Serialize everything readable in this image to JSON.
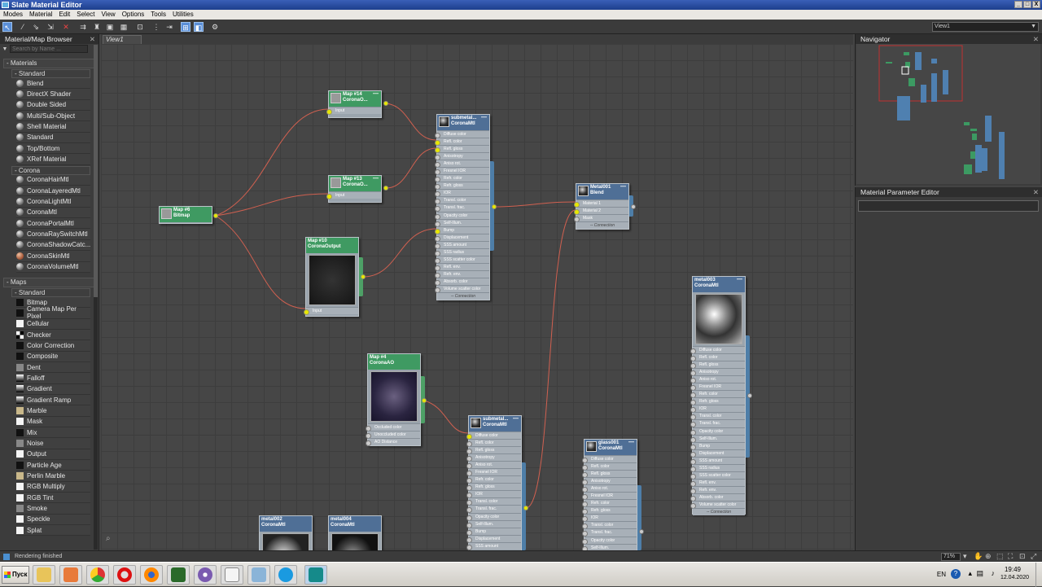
{
  "window": {
    "title": "Slate Material Editor",
    "controls": [
      "_",
      "□",
      "X"
    ]
  },
  "menu": [
    "Modes",
    "Material",
    "Edit",
    "Select",
    "View",
    "Options",
    "Tools",
    "Utilities"
  ],
  "view_select": "View1",
  "browser": {
    "title": "Material/Map Browser",
    "search_placeholder": "Search by Name ...",
    "materials_label": "- Materials",
    "standard_label": "- Standard",
    "standard_items": [
      {
        "label": "Blend",
        "icon": "sphere-icon"
      },
      {
        "label": "DirectX Shader",
        "icon": "sphere-icon"
      },
      {
        "label": "Double Sided",
        "icon": "sphere-icon"
      },
      {
        "label": "Multi/Sub-Object",
        "icon": "sphere-icon"
      },
      {
        "label": "Shell Material",
        "icon": "sphere-icon"
      },
      {
        "label": "Standard",
        "icon": "sphere-icon"
      },
      {
        "label": "Top/Bottom",
        "icon": "sphere-icon"
      },
      {
        "label": "XRef Material",
        "icon": "sphere-icon"
      }
    ],
    "corona_label": "- Corona",
    "corona_items": [
      {
        "label": "CoronaHairMtl",
        "icon": "sphere-icon"
      },
      {
        "label": "CoronaLayeredMtl",
        "icon": "sphere-icon"
      },
      {
        "label": "CoronaLightMtl",
        "icon": "sphere-icon"
      },
      {
        "label": "CoronaMtl",
        "icon": "sphere-icon"
      },
      {
        "label": "CoronaPortalMtl",
        "icon": "sphere-icon"
      },
      {
        "label": "CoronaRaySwitchMtl",
        "icon": "sphere-icon"
      },
      {
        "label": "CoronaShadowCatc...",
        "icon": "sphere-icon"
      },
      {
        "label": "CoronaSkinMtl",
        "icon": "sphere-icon"
      },
      {
        "label": "CoronaVolumeMtl",
        "icon": "sphere-icon"
      }
    ],
    "maps_label": "- Maps",
    "maps_standard_label": "- Standard",
    "map_items": [
      {
        "label": "Bitmap",
        "icon": "black-swatch-icon"
      },
      {
        "label": "Camera Map Per Pixel",
        "icon": "black-swatch-icon"
      },
      {
        "label": "Cellular",
        "icon": "white-swatch-icon"
      },
      {
        "label": "Checker",
        "icon": "checker-icon"
      },
      {
        "label": "Color Correction",
        "icon": "black-swatch-icon"
      },
      {
        "label": "Composite",
        "icon": "black-swatch-icon"
      },
      {
        "label": "Dent",
        "icon": "noise-swatch-icon"
      },
      {
        "label": "Falloff",
        "icon": "gradient-swatch-icon"
      },
      {
        "label": "Gradient",
        "icon": "gradient-swatch-icon"
      },
      {
        "label": "Gradient Ramp",
        "icon": "gradient-swatch-icon"
      },
      {
        "label": "Marble",
        "icon": "marble-swatch-icon"
      },
      {
        "label": "Mask",
        "icon": "white-swatch-icon"
      },
      {
        "label": "Mix",
        "icon": "black-swatch-icon"
      },
      {
        "label": "Noise",
        "icon": "noise-swatch-icon"
      },
      {
        "label": "Output",
        "icon": "white-swatch-icon"
      },
      {
        "label": "Particle Age",
        "icon": "black-swatch-icon"
      },
      {
        "label": "Perlin Marble",
        "icon": "marble-swatch-icon"
      },
      {
        "label": "RGB Multiply",
        "icon": "white-swatch-icon"
      },
      {
        "label": "RGB Tint",
        "icon": "white-swatch-icon"
      },
      {
        "label": "Smoke",
        "icon": "noise-swatch-icon"
      },
      {
        "label": "Speckle",
        "icon": "white-swatch-icon"
      },
      {
        "label": "Splat",
        "icon": "white-swatch-icon"
      }
    ]
  },
  "view_tab": "View1",
  "nodes": {
    "map14": {
      "title": "Map #14",
      "sub": "CoronaO...",
      "slots": [
        "Input"
      ]
    },
    "map13": {
      "title": "Map #13",
      "sub": "CoronaO...",
      "slots": [
        "Input"
      ]
    },
    "map6": {
      "title": "Map #6",
      "sub": "Bitmap"
    },
    "map10": {
      "title": "Map #10",
      "sub": "CoronaOutput",
      "slots": [
        "Input"
      ]
    },
    "submetal1": {
      "title": "submetal...",
      "sub": "CoronaMtl",
      "slots": [
        "Diffuse color",
        "Refl. color",
        "Refl. gloss",
        "Anisotropy",
        "Aniso rot.",
        "Fresnel IOR",
        "Refr. color",
        "Refr. gloss",
        "IOR",
        "Transl. color",
        "Transl. frac.",
        "Opacity color",
        "Self-Illum.",
        "Bump",
        "Displacement",
        "SSS amount",
        "SSS radius",
        "SSS scatter color",
        "Refl. env.",
        "Refr. env.",
        "Absorb. color",
        "Volume scatter color"
      ],
      "conn": "-- Connection"
    },
    "metal001": {
      "title": "Metal001",
      "sub": "Blend",
      "slots": [
        "Material 1",
        "Material 2",
        "Mask"
      ],
      "conn": "-- Connection"
    },
    "map4": {
      "title": "Map #4",
      "sub": "CoronaAO",
      "slots": [
        "Occluded color",
        "Unoccluded color",
        "AO Distance"
      ]
    },
    "submetal2": {
      "title": "submetal...",
      "sub": "CoronaMtl",
      "slots": [
        "Diffuse color",
        "Refl. color",
        "Refl. gloss",
        "Anisotropy",
        "Aniso rot.",
        "Fresnel IOR",
        "Refr. color",
        "Refr. gloss",
        "IOR",
        "Transl. color",
        "Transl. frac.",
        "Opacity color",
        "Self-Illum.",
        "Bump",
        "Displacement",
        "SSS amount"
      ]
    },
    "glass001": {
      "title": "glass001",
      "sub": "CoronaMtl",
      "slots": [
        "Diffuse color",
        "Refl. color",
        "Refl. gloss",
        "Anisotropy",
        "Aniso rot.",
        "Fresnel IOR",
        "Refr. color",
        "Refr. gloss",
        "IOR",
        "Transl. color",
        "Transl. frac.",
        "Opacity color",
        "Self-Illum."
      ]
    },
    "metal003": {
      "title": "metal003",
      "sub": "CoronaMtl",
      "slots": [
        "Diffuse color",
        "Refl. color",
        "Refl. gloss",
        "Anisotropy",
        "Aniso rot.",
        "Fresnel IOR",
        "Refr. color",
        "Refr. gloss",
        "IOR",
        "Transl. color",
        "Transl. frac.",
        "Opacity color",
        "Self-Illum.",
        "Bump",
        "Displacement",
        "SSS amount",
        "SSS radius",
        "SSS scatter color",
        "Refl. env.",
        "Refr. env.",
        "Absorb. color",
        "Volume scatter color"
      ],
      "conn": "-- Connection"
    },
    "metal002": {
      "title": "metal002",
      "sub": "CoronaMtl"
    },
    "metal004": {
      "title": "metal004",
      "sub": "CoronaMtl"
    }
  },
  "navigator_title": "Navigator",
  "mpe_title": "Material Parameter Editor",
  "status": {
    "text": "Rendering finished",
    "zoom": "71%"
  },
  "taskbar": {
    "start": "Пуск",
    "lang": "EN",
    "time": "19:49",
    "date": "12.04.2020"
  },
  "colors": {
    "accent": "#4f6f96",
    "map_header": "#3f9a62",
    "wire": "#d06050",
    "socket": "#e8e800"
  }
}
